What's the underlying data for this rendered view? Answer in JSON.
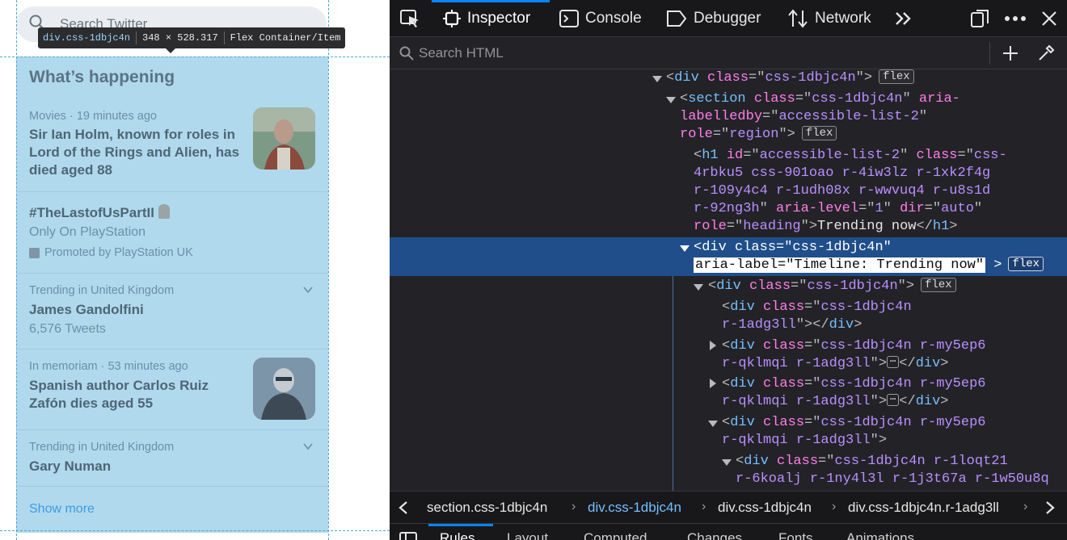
{
  "preview": {
    "search_placeholder": "Search Twitter",
    "tooltip": {
      "selector": "div.css-1dbjc4n",
      "dimensions": "348 × 528.317",
      "type": "Flex Container/Item"
    },
    "section_title": "What’s happening",
    "trends": [
      {
        "meta": "Movies · 19 minutes ago",
        "headline": "Sir Ian Holm, known for roles in Lord of the Rings and Alien, has died aged 88"
      },
      {
        "headline": "#TheLastofUsPartII",
        "sub": "Only On PlayStation",
        "promo": "Promoted by PlayStation UK"
      },
      {
        "meta": "Trending in United Kingdom",
        "headline": "James Gandolfini",
        "sub": "6,576 Tweets"
      },
      {
        "meta": "In memoriam · 53 minutes ago",
        "headline": "Spanish author Carlos Ruiz Zafón dies aged 55"
      },
      {
        "meta": "Trending in United Kingdom",
        "headline": "Gary Numan"
      }
    ],
    "show_more": "Show more"
  },
  "devtools": {
    "tabs": [
      "Inspector",
      "Console",
      "Debugger",
      "Network"
    ],
    "search_placeholder": "Search HTML",
    "badge": "flex",
    "ellipsis": "⋯",
    "tree": {
      "l1": {
        "tag": "div",
        "cls": "css-1dbjc4n"
      },
      "l2a": "section",
      "l2b": "css-1dbjc4n",
      "l2c": "accessible-list-2",
      "l2d": "region",
      "h1_id": "accessible-list-2",
      "h1_cls_1": "css-",
      "h1_cls_2": "4rbku5 css-901oao r-4iw3lz r-1xk2f4g",
      "h1_cls_3": "r-109y4c4 r-1udh08x r-wwvuq4 r-u8s1d",
      "h1_cls_4": "r-92ng3h",
      "h1_dir": "auto",
      "h1_role": "heading",
      "h1_text": "Trending now",
      "sel_cls": "css-1dbjc4n",
      "sel_aria": "aria-label=\"Timeline: Trending now\"",
      "c1_cls": "css-1dbjc4n",
      "c2_cls_1": "css-1dbjc4n",
      "c2_cls_2": "r-1adg3ll",
      "c3_cls_1": "css-1dbjc4n r-my5ep6",
      "c3_cls_2": "r-qklmqi r-1adg3ll",
      "c6_cls_1": "css-1dbjc4n r-1loqt21",
      "c6_cls_2": "r-6koalj r-1ny4l3l r-1j3t67a r-1w50u8q"
    },
    "breadcrumbs": [
      "section.css-1dbjc4n",
      "div.css-1dbjc4n",
      "div.css-1dbjc4n",
      "div.css-1dbjc4n.r-1adg3ll"
    ],
    "bottom_tabs": [
      "Rules",
      "Layout",
      "Computed",
      "Changes",
      "Fonts",
      "Animations"
    ]
  }
}
